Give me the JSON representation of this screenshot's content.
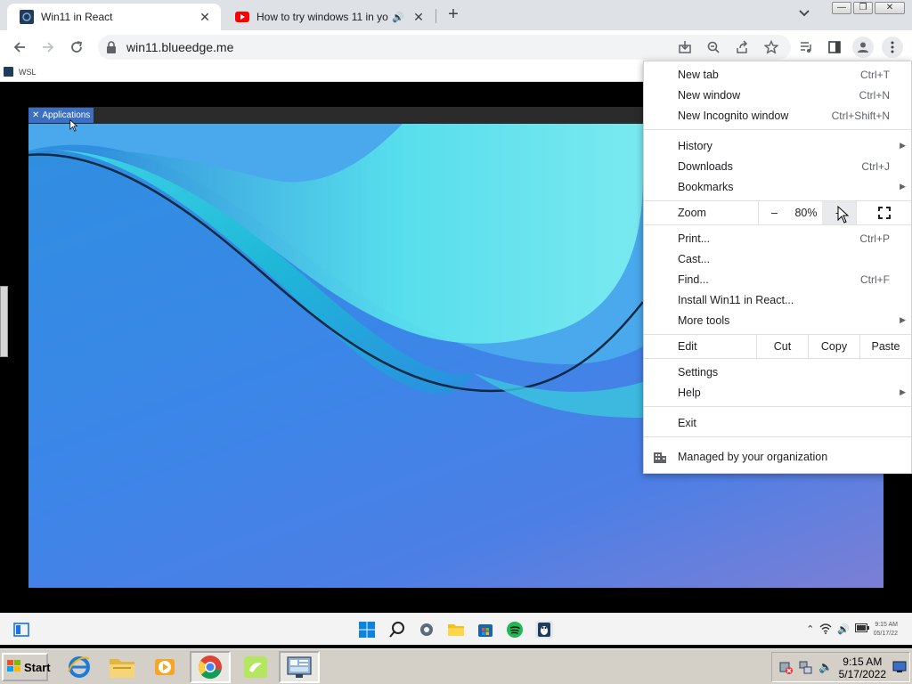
{
  "browser": {
    "tabs": [
      {
        "title": "Win11 in React",
        "active": true
      },
      {
        "title": "How to try windows 11 in yo",
        "active": false
      }
    ],
    "new_tab_symbol": "+",
    "url": "win11.blueedge.me",
    "bookmarks": [
      {
        "label": "WSL"
      }
    ]
  },
  "page": {
    "applications_label": "Applications"
  },
  "menu": {
    "group1": [
      {
        "label": "New tab",
        "shortcut": "Ctrl+T"
      },
      {
        "label": "New window",
        "shortcut": "Ctrl+N"
      },
      {
        "label": "New Incognito window",
        "shortcut": "Ctrl+Shift+N"
      }
    ],
    "group2": [
      {
        "label": "History",
        "shortcut": ""
      },
      {
        "label": "Downloads",
        "shortcut": "Ctrl+J"
      },
      {
        "label": "Bookmarks",
        "shortcut": ""
      }
    ],
    "zoom": {
      "label": "Zoom",
      "minus": "–",
      "value": "80%",
      "plus": "+"
    },
    "group3": [
      {
        "label": "Print...",
        "shortcut": "Ctrl+P"
      },
      {
        "label": "Cast...",
        "shortcut": ""
      },
      {
        "label": "Find...",
        "shortcut": "Ctrl+F"
      },
      {
        "label": "Install Win11 in React...",
        "shortcut": ""
      },
      {
        "label": "More tools",
        "shortcut": ""
      }
    ],
    "edit": {
      "label": "Edit",
      "cut": "Cut",
      "copy": "Copy",
      "paste": "Paste"
    },
    "group4": [
      {
        "label": "Settings",
        "shortcut": ""
      },
      {
        "label": "Help",
        "shortcut": ""
      }
    ],
    "exit": "Exit",
    "managed": "Managed by your organization"
  },
  "win11_taskbar": {
    "clock_time": "9:15 AM",
    "clock_date": "05/17/22"
  },
  "os_taskbar": {
    "start_label": "Start",
    "clock_time": "9:15 AM",
    "clock_date": "5/17/2022"
  },
  "colors": {
    "accent": "#1a73e8",
    "youtube": "#ff0000",
    "desktop_blue": "#3b86e8",
    "wave_cyan": "#4fe3e3"
  }
}
